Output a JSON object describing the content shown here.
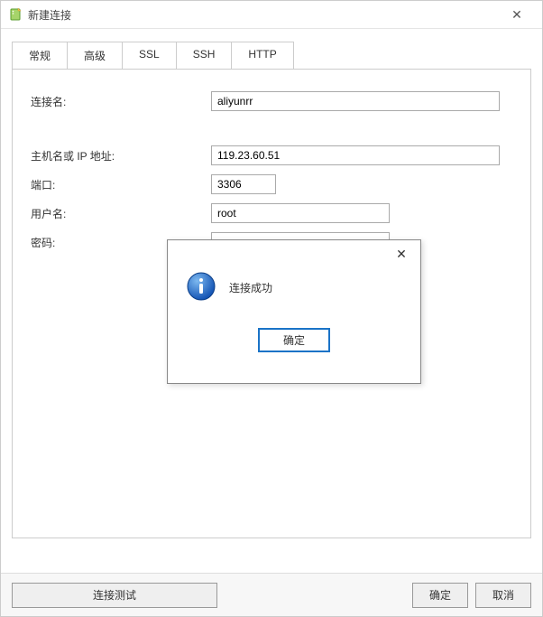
{
  "window": {
    "title": "新建连接",
    "close_glyph": "✕"
  },
  "tabs": {
    "items": [
      {
        "label": "常规",
        "active": true
      },
      {
        "label": "高级",
        "active": false
      },
      {
        "label": "SSL",
        "active": false
      },
      {
        "label": "SSH",
        "active": false
      },
      {
        "label": "HTTP",
        "active": false
      }
    ]
  },
  "form": {
    "conn_name_label": "连接名:",
    "conn_name_value": "aliyunrr",
    "host_label": "主机名或 IP 地址:",
    "host_value": "119.23.60.51",
    "port_label": "端口:",
    "port_value": "3306",
    "user_label": "用户名:",
    "user_value": "root",
    "pass_label": "密码:",
    "pass_value": "••••••••"
  },
  "footer": {
    "test_label": "连接测试",
    "ok_label": "确定",
    "cancel_label": "取消"
  },
  "modal": {
    "close_glyph": "✕",
    "message": "连接成功",
    "ok_label": "确定"
  }
}
